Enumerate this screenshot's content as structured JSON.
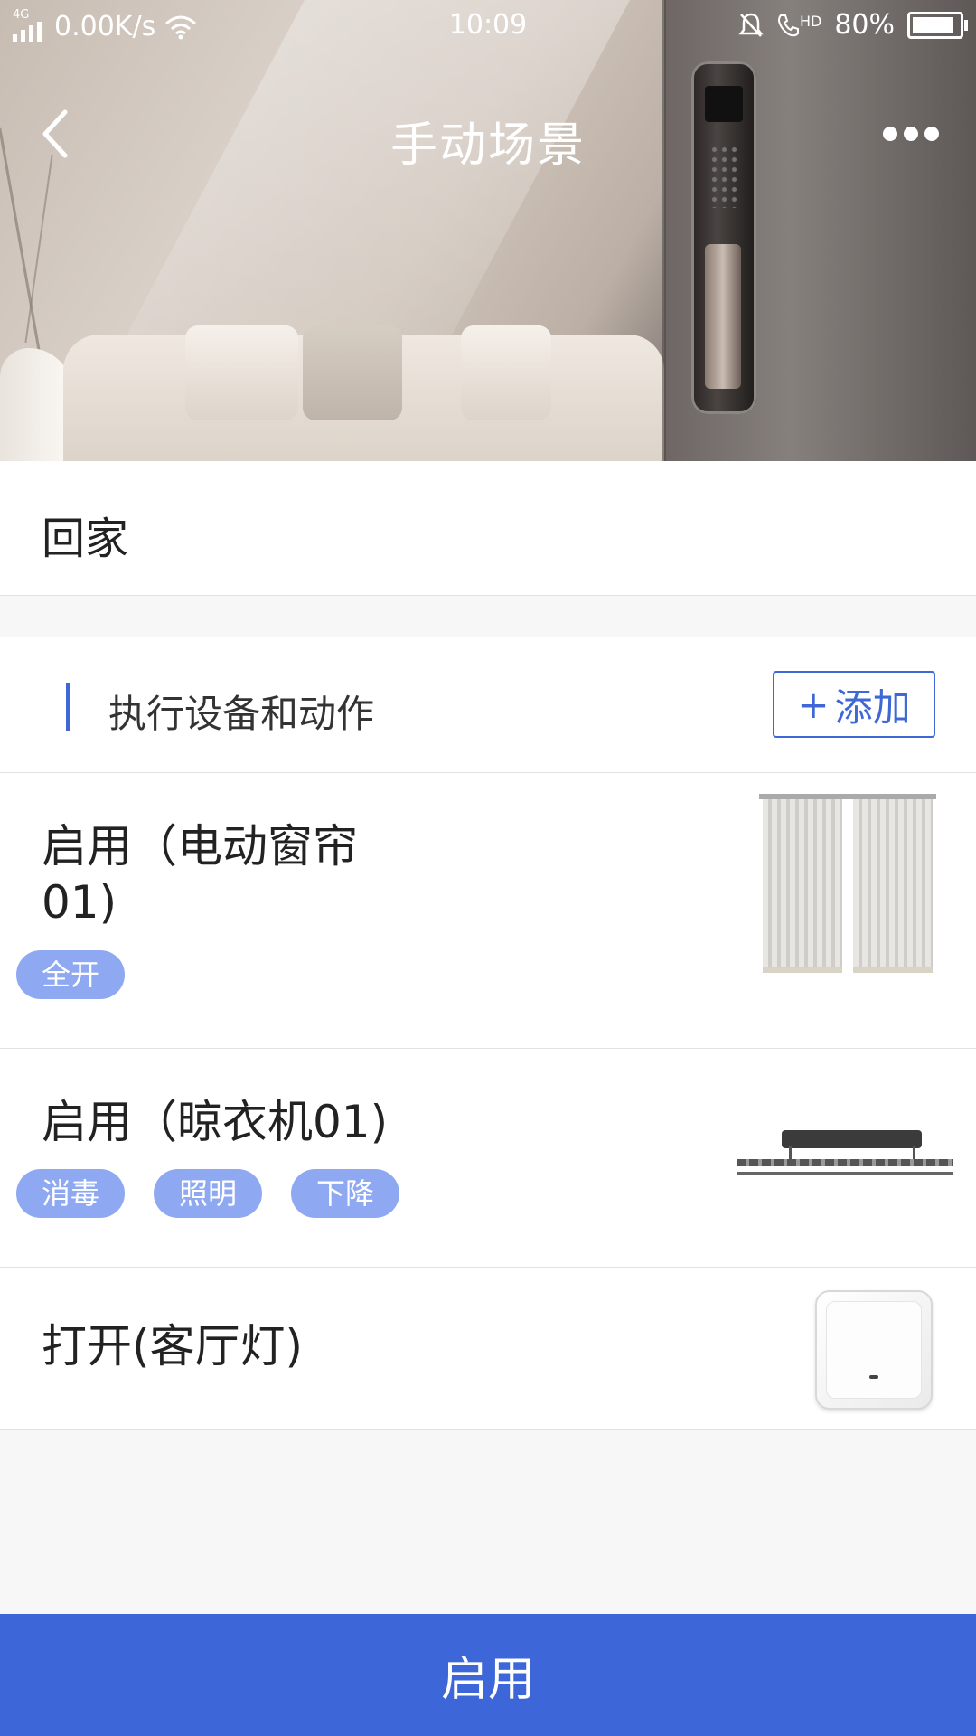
{
  "status_bar": {
    "network": "4G",
    "speed": "0.00K/s",
    "time": "10:09",
    "hd": "HD",
    "battery": "80%"
  },
  "header": {
    "title": "手动场景"
  },
  "scene": {
    "name": "回家"
  },
  "actions": {
    "title": "执行设备和动作",
    "add_label": "添加",
    "add_icon": "+"
  },
  "devices": [
    {
      "line1": "启用（电动窗帘",
      "line2": "01)",
      "tags": [
        "全开"
      ],
      "icon": "curtain-image"
    },
    {
      "line1": "启用（晾衣机01)",
      "tags": [
        "消毒",
        "照明",
        "下降"
      ],
      "icon": "drying-rack-image"
    },
    {
      "line1": "打开(客厅灯)",
      "tags": [],
      "icon": "light-switch-image"
    }
  ],
  "footer": {
    "enable_label": "启用"
  },
  "colors": {
    "accent": "#3d67d8",
    "tag": "#8fa8f2"
  }
}
